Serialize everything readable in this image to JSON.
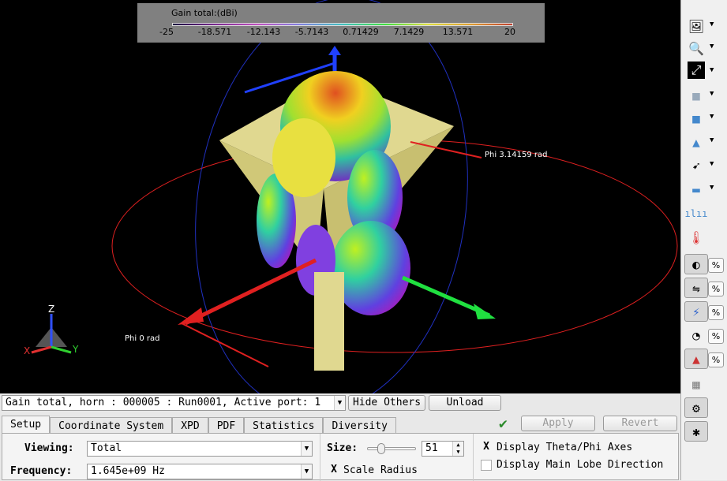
{
  "legend": {
    "title": "Gain total:(dBi)",
    "ticks": [
      "-25",
      "-18.571",
      "-12.143",
      "-5.7143",
      "0.71429",
      "7.1429",
      "13.571",
      "20"
    ]
  },
  "viewport": {
    "phi_pi_label": "Phi 3.14159 rad",
    "phi_0_label": "Phi 0 rad",
    "axes": {
      "x": "X",
      "y": "Y",
      "z": "Z"
    }
  },
  "runbar": {
    "selected_run": "Gain total, horn : 000005 : Run0001, Active port: 1",
    "hide_others": "Hide Others",
    "unload": "Unload"
  },
  "tabs": [
    "Setup",
    "Coordinate System",
    "XPD",
    "PDF",
    "Statistics",
    "Diversity"
  ],
  "actions": {
    "apply": "Apply",
    "revert": "Revert"
  },
  "setup": {
    "viewing_label": "Viewing:",
    "viewing_value": "Total",
    "frequency_label": "Frequency:",
    "frequency_value": "1.645e+09 Hz",
    "size_label": "Size:",
    "size_value": "51",
    "size_slider_fraction": 0.3,
    "scale_radius_label": "Scale Radius",
    "scale_radius_checked": true,
    "display_axes_label": "Display Theta/Phi Axes",
    "display_axes_checked": true,
    "display_lobe_label": "Display Main Lobe Direction",
    "display_lobe_checked": false
  },
  "toolbar": {
    "pct": "%"
  },
  "check_mark": "X"
}
